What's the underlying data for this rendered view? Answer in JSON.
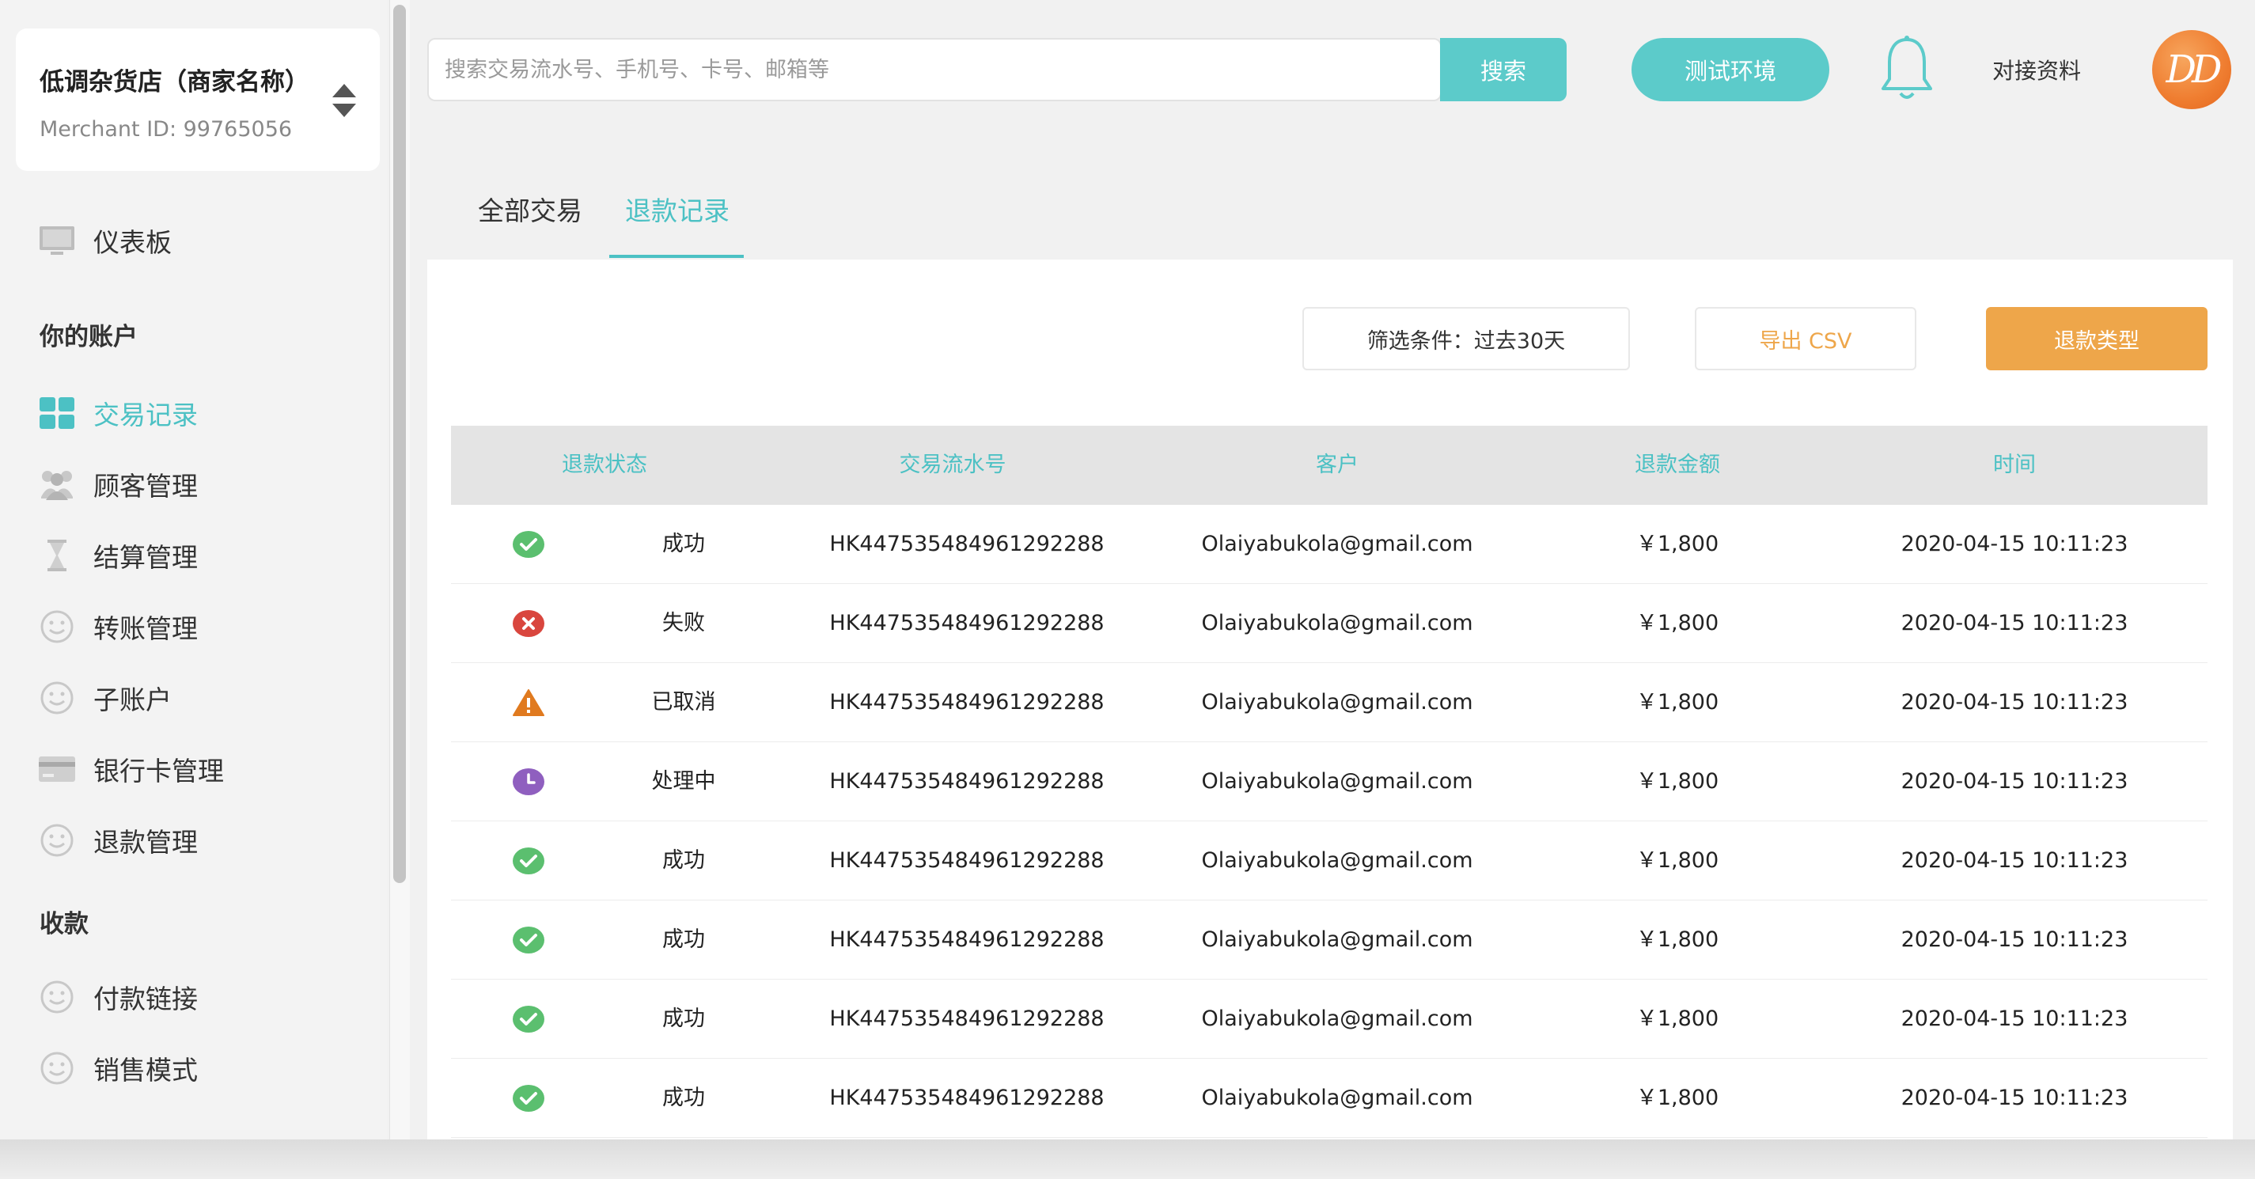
{
  "merchant": {
    "name": "低调杂货店（商家名称）",
    "id_label": "Merchant ID: 99765056"
  },
  "sidebar": {
    "dashboard": "仪表板",
    "section_account": "你的账户",
    "items": [
      {
        "label": "交易记录",
        "icon": "grid-icon"
      },
      {
        "label": "顾客管理",
        "icon": "users-icon"
      },
      {
        "label": "结算管理",
        "icon": "hourglass-icon"
      },
      {
        "label": "转账管理",
        "icon": "smiley-icon"
      },
      {
        "label": "子账户",
        "icon": "smiley-icon"
      },
      {
        "label": "银行卡管理",
        "icon": "card-icon"
      },
      {
        "label": "退款管理",
        "icon": "smiley-icon"
      }
    ],
    "section_collect": "收款",
    "collect_items": [
      {
        "label": "付款链接",
        "icon": "smiley-icon"
      },
      {
        "label": "销售模式",
        "icon": "smiley-icon"
      }
    ]
  },
  "topbar": {
    "search_placeholder": "搜索交易流水号、手机号、卡号、邮箱等",
    "search_button": "搜索",
    "env_button": "测试环境",
    "docs_link": "对接资料",
    "avatar_text": "DD"
  },
  "tabs": {
    "all": "全部交易",
    "refund": "退款记录"
  },
  "toolbar": {
    "filter": "筛选条件：过去30天",
    "export": "导出 CSV",
    "refund_type": "退款类型"
  },
  "colors": {
    "accent": "#4cc1c4",
    "orange": "#eea64a",
    "success": "#5bbf6f",
    "failed": "#d9463e",
    "cancelled": "#e07a1f",
    "processing": "#8f5fbf"
  },
  "table": {
    "headers": [
      "退款状态",
      "交易流水号",
      "客户",
      "退款金额",
      "时间"
    ],
    "rows": [
      {
        "status": "success",
        "status_label": "成功",
        "txn": "HK447535484961292288",
        "customer": "Olaiyabukola@gmail.com",
        "amount": "￥1,800",
        "time": "2020-04-15 10:11:23"
      },
      {
        "status": "failed",
        "status_label": "失败",
        "txn": "HK447535484961292288",
        "customer": "Olaiyabukola@gmail.com",
        "amount": "￥1,800",
        "time": "2020-04-15 10:11:23"
      },
      {
        "status": "cancelled",
        "status_label": "已取消",
        "txn": "HK447535484961292288",
        "customer": "Olaiyabukola@gmail.com",
        "amount": "￥1,800",
        "time": "2020-04-15 10:11:23"
      },
      {
        "status": "processing",
        "status_label": "处理中",
        "txn": "HK447535484961292288",
        "customer": "Olaiyabukola@gmail.com",
        "amount": "￥1,800",
        "time": "2020-04-15 10:11:23"
      },
      {
        "status": "success",
        "status_label": "成功",
        "txn": "HK447535484961292288",
        "customer": "Olaiyabukola@gmail.com",
        "amount": "￥1,800",
        "time": "2020-04-15 10:11:23"
      },
      {
        "status": "success",
        "status_label": "成功",
        "txn": "HK447535484961292288",
        "customer": "Olaiyabukola@gmail.com",
        "amount": "￥1,800",
        "time": "2020-04-15 10:11:23"
      },
      {
        "status": "success",
        "status_label": "成功",
        "txn": "HK447535484961292288",
        "customer": "Olaiyabukola@gmail.com",
        "amount": "￥1,800",
        "time": "2020-04-15 10:11:23"
      },
      {
        "status": "success",
        "status_label": "成功",
        "txn": "HK447535484961292288",
        "customer": "Olaiyabukola@gmail.com",
        "amount": "￥1,800",
        "time": "2020-04-15 10:11:23"
      }
    ]
  }
}
